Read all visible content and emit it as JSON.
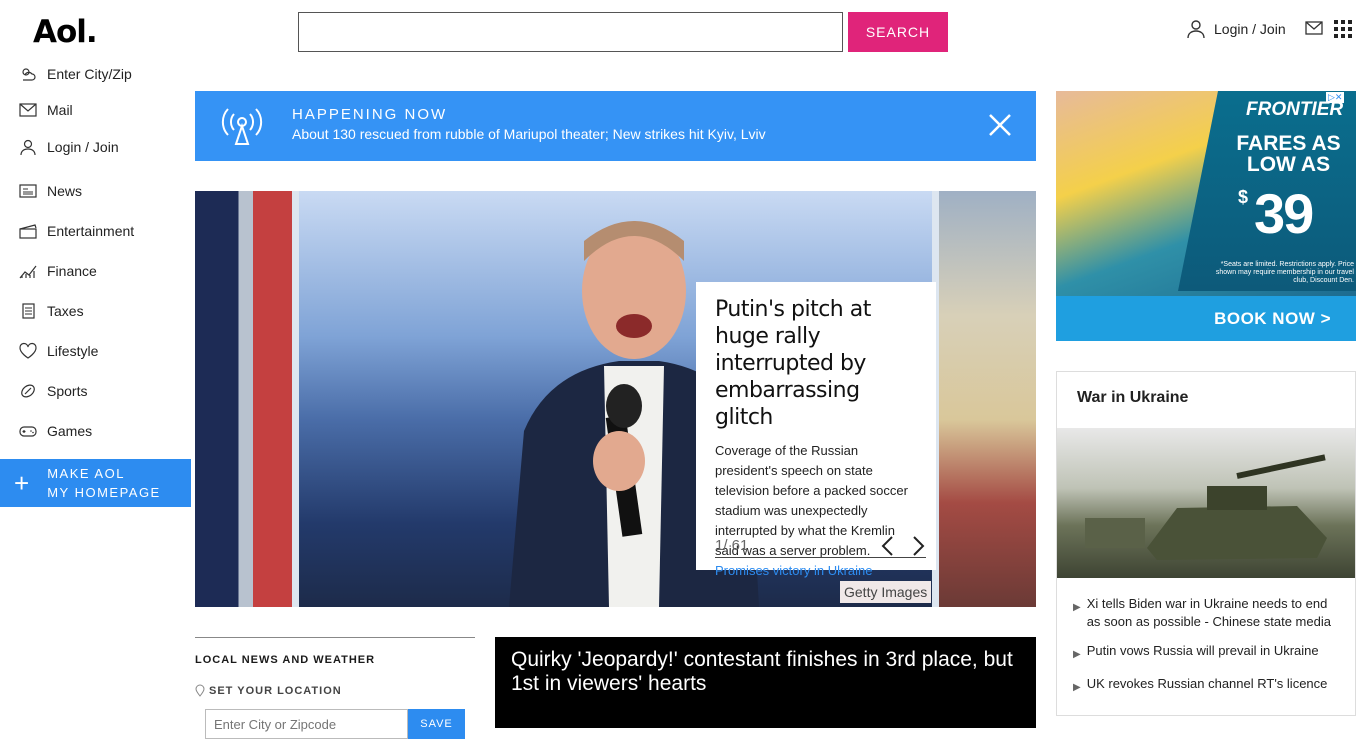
{
  "header": {
    "logo": "Aol.",
    "search_button": "SEARCH",
    "login": "Login / Join"
  },
  "nav": {
    "items": [
      {
        "label": "Enter City/Zip",
        "icon": "weather-icon"
      },
      {
        "label": "Mail",
        "icon": "mail-icon"
      },
      {
        "label": "Login / Join",
        "icon": "user-icon"
      },
      {
        "label": "News",
        "icon": "news-icon"
      },
      {
        "label": "Entertainment",
        "icon": "clapper-icon"
      },
      {
        "label": "Finance",
        "icon": "chart-icon"
      },
      {
        "label": "Taxes",
        "icon": "document-icon"
      },
      {
        "label": "Lifestyle",
        "icon": "heart-icon"
      },
      {
        "label": "Sports",
        "icon": "ball-icon"
      },
      {
        "label": "Games",
        "icon": "gamepad-icon"
      }
    ],
    "make_home_line1": "MAKE AOL",
    "make_home_line2": "MY HOMEPAGE"
  },
  "banner": {
    "label": "HAPPENING NOW",
    "text": "About 130 rescued from rubble of Mariupol theater; New strikes hit Kyiv, Lviv"
  },
  "slider": {
    "headline": "Putin's pitch at huge rally interrupted by embarrassing glitch",
    "summary": "Coverage of the Russian president's speech on state television before a packed soccer stadium was unexpectedly interrupted by what the Kremlin said was a server problem.",
    "link": "Promises victory in Ukraine",
    "counter": "1/ 61",
    "credit": "Getty Images"
  },
  "local": {
    "heading": "LOCAL NEWS AND WEATHER",
    "set_location": "SET YOUR LOCATION",
    "placeholder": "Enter City or Zipcode",
    "save": "SAVE"
  },
  "video": {
    "title": "Quirky 'Jeopardy!' contestant finishes in 3rd place, but 1st in viewers' hearts"
  },
  "ad": {
    "brand": "FRONTIER",
    "fares": "FARES AS LOW AS",
    "dollar": "$",
    "price": "39",
    "fine_print": "*Seats are limited. Restrictions apply. Price shown may require membership in our travel club, Discount Den.",
    "cta": "BOOK NOW >"
  },
  "ukraine": {
    "title": "War in Ukraine",
    "links": [
      "Xi tells Biden war in Ukraine needs to end as soon as possible - Chinese state media",
      "Putin vows Russia will prevail in Ukraine",
      "UK revokes Russian channel RT's licence"
    ]
  },
  "colors": {
    "accent_blue": "#2d8cf0",
    "banner_blue": "#3593f5",
    "search_pink": "#e0247a"
  }
}
